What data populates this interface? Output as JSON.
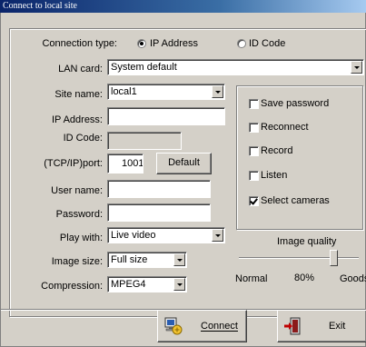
{
  "window": {
    "title": "Connect to local site"
  },
  "connection_type": {
    "label": "Connection type:",
    "options": [
      {
        "label": "IP Address",
        "checked": true
      },
      {
        "label": "ID Code",
        "checked": false
      }
    ]
  },
  "lan_card": {
    "label": "LAN card:",
    "value": "System default"
  },
  "site_name": {
    "label": "Site name:",
    "value": "local1"
  },
  "ip_address": {
    "label": "IP Address:",
    "value": ""
  },
  "id_code": {
    "label": "ID Code:",
    "value": ""
  },
  "port": {
    "label": "(TCP/IP)port:",
    "value": "1001",
    "default_button": "Default"
  },
  "user_name": {
    "label": "User name:",
    "value": ""
  },
  "password": {
    "label": "Password:",
    "value": ""
  },
  "play_with": {
    "label": "Play with:",
    "value": "Live video"
  },
  "image_size": {
    "label": "Image size:",
    "value": "Full size"
  },
  "compression": {
    "label": "Compression:",
    "value": "MPEG4"
  },
  "options": [
    {
      "label": "Save password",
      "checked": false
    },
    {
      "label": "Reconnect",
      "checked": false
    },
    {
      "label": "Record",
      "checked": false
    },
    {
      "label": "Listen",
      "checked": false
    },
    {
      "label": "Select cameras",
      "checked": true
    }
  ],
  "image_quality": {
    "label": "Image quality",
    "min_label": "Normal",
    "value_label": "80%",
    "max_label": "Goods",
    "value": 0.8
  },
  "buttons": {
    "connect": "Connect",
    "exit": "Exit"
  },
  "colors": {
    "titlebar_start": "#0a246a",
    "titlebar_end": "#a6caf0",
    "face": "#d4d0c8"
  }
}
